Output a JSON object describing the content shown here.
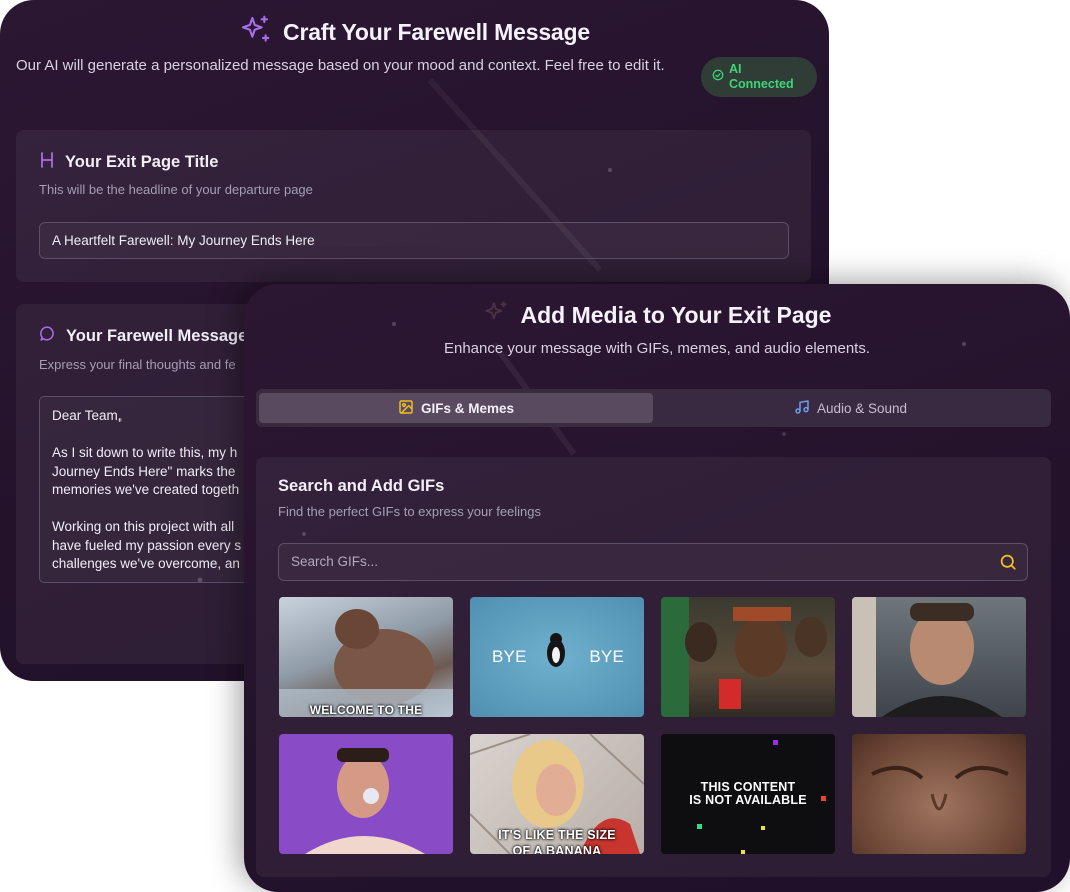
{
  "farewell_panel": {
    "title": "Craft Your Farewell Message",
    "description": "Our AI will generate a personalized message based on your mood and context. Feel free to edit it.",
    "ai_status": "AI Connected",
    "title_card": {
      "heading": "Your Exit Page Title",
      "subtitle": "This will be the headline of your departure page",
      "value": "A Heartfelt Farewell: My Journey Ends Here"
    },
    "message_card": {
      "heading": "Your Farewell Message",
      "subtitle": "Express your final thoughts and fe",
      "value": "Dear Team,\n\nAs I sit down to write this, my h\nJourney Ends Here\" marks the\nmemories we've created togeth\n\nWorking on this project with all\nhave fueled my passion every s\nchallenges we've overcome, an"
    }
  },
  "media_panel": {
    "title": "Add Media to Your Exit Page",
    "description": "Enhance your message with GIFs, memes, and audio elements.",
    "tabs": [
      {
        "label": "GIFs & Memes",
        "active": true
      },
      {
        "label": "Audio & Sound",
        "active": false
      }
    ],
    "gif_section": {
      "heading": "Search and Add GIFs",
      "subtitle": "Find the perfect GIFs to express your feelings",
      "search_placeholder": "Search GIFs..."
    },
    "gifs": [
      {
        "caption": "WELCOME TO THE"
      },
      {
        "caption_left": "BYE",
        "caption_right": "BYE"
      },
      {
        "caption": ""
      },
      {
        "caption": ""
      },
      {
        "caption": ""
      },
      {
        "caption": "IT'S LIKE THE SIZE",
        "caption2": "OF A BANANA"
      },
      {
        "caption": "THIS CONTENT",
        "caption2": "IS NOT AVAILABLE"
      },
      {
        "caption": ""
      }
    ]
  },
  "colors": {
    "accent_purple": "#a66ee8",
    "ai_green": "#3ed47b",
    "icon_yellow": "#f1c021",
    "icon_blue": "#6fa0f0"
  }
}
